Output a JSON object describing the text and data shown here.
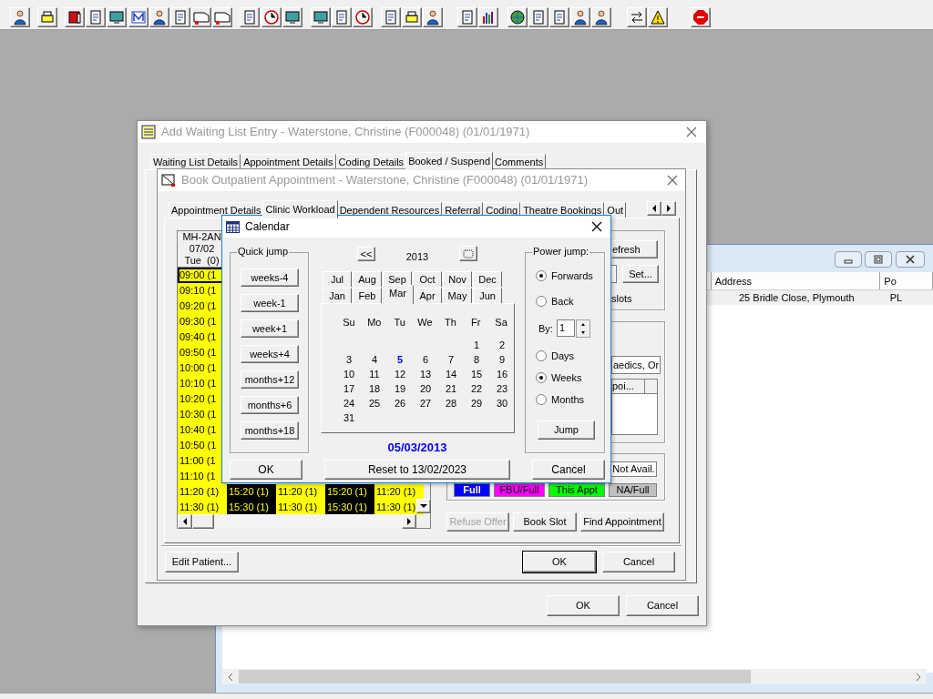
{
  "background_window": {
    "columns": [
      {
        "label": "Address"
      },
      {
        "label": "Po"
      }
    ],
    "rows": [
      {
        "cells": [
          "25 Bridle Close, Plymouth",
          "PL"
        ]
      }
    ]
  },
  "waiting_list_window": {
    "title": "Add Waiting List Entry - Waterstone, Christine (F000048) (01/01/1971)",
    "tabs": [
      {
        "label": "Waiting List Details",
        "selected": false
      },
      {
        "label": "Appointment Details",
        "selected": false
      },
      {
        "label": "Coding Details",
        "selected": false
      },
      {
        "label": "Booked / Suspend",
        "selected": true
      },
      {
        "label": "Comments",
        "selected": false
      }
    ],
    "buttons": [
      "OK",
      "Cancel"
    ]
  },
  "book_window": {
    "title": "Book Outpatient Appointment - Waterstone, Christine (F000048) (01/01/1971)",
    "tabs": [
      {
        "label": "Appointment Details",
        "selected": false
      },
      {
        "label": "Clinic Workload",
        "selected": true
      },
      {
        "label": "Dependent Resources",
        "selected": false
      },
      {
        "label": "Referral",
        "selected": false
      },
      {
        "label": "Coding",
        "selected": false
      },
      {
        "label": "Theatre Bookings",
        "selected": false
      },
      {
        "label": "Out",
        "selected": false
      }
    ],
    "grid": {
      "header": [
        "MH-2AN",
        "07/02",
        "Tue  (0)"
      ],
      "rows": [
        {
          "cells": [
            {
              "text": "09:00 (1",
              "kind": "free",
              "selected": true
            }
          ]
        },
        {
          "cells": [
            {
              "text": "09:10 (1",
              "kind": "free",
              "selected": false
            }
          ]
        },
        {
          "cells": [
            {
              "text": "09:20 (1",
              "kind": "free",
              "selected": false
            }
          ]
        },
        {
          "cells": [
            {
              "text": "09:30 (1",
              "kind": "free",
              "selected": false
            }
          ]
        },
        {
          "cells": [
            {
              "text": "09:40 (1",
              "kind": "free",
              "selected": false
            }
          ]
        },
        {
          "cells": [
            {
              "text": "09:50 (1",
              "kind": "free",
              "selected": false
            }
          ]
        },
        {
          "cells": [
            {
              "text": "10:00 (1",
              "kind": "free",
              "selected": false
            }
          ]
        },
        {
          "cells": [
            {
              "text": "10:10 (1",
              "kind": "free",
              "selected": false
            }
          ]
        },
        {
          "cells": [
            {
              "text": "10:20 (1",
              "kind": "free",
              "selected": false
            }
          ]
        },
        {
          "cells": [
            {
              "text": "10:30 (1",
              "kind": "free",
              "selected": false
            }
          ]
        },
        {
          "cells": [
            {
              "text": "10:40 (1",
              "kind": "free",
              "selected": false
            }
          ]
        },
        {
          "cells": [
            {
              "text": "10:50 (1",
              "kind": "free",
              "selected": false
            }
          ]
        },
        {
          "cells": [
            {
              "text": "11:00 (1",
              "kind": "free",
              "selected": false
            }
          ]
        },
        {
          "cells": [
            {
              "text": "11:10 (1",
              "kind": "free",
              "selected": false
            }
          ]
        },
        {
          "cells": [
            {
              "text": "11:20 (1)",
              "kind": "free",
              "selected": false
            },
            {
              "text": "15:20 (1)",
              "kind": "booked",
              "selected": false
            },
            {
              "text": "11:20 (1)",
              "kind": "free",
              "selected": false
            },
            {
              "text": "15:20 (1)",
              "kind": "booked",
              "selected": false
            },
            {
              "text": "11:20 (1)",
              "kind": "free",
              "selected": false
            }
          ]
        },
        {
          "cells": [
            {
              "text": "11:30 (1)",
              "kind": "free",
              "selected": false
            },
            {
              "text": "15:30 (1)",
              "kind": "booked",
              "selected": false
            },
            {
              "text": "11:30 (1)",
              "kind": "free",
              "selected": false
            },
            {
              "text": "15:30 (1)",
              "kind": "booked",
              "selected": false
            },
            {
              "text": "11:30 (1)",
              "kind": "free",
              "selected": false
            }
          ]
        }
      ]
    },
    "refresh_button": "efresh",
    "set_button": "Set...",
    "slots_label": "slots",
    "specialty_field": "aedics, Or",
    "list_header": "poi...",
    "legend": [
      {
        "label": "Not Avail.",
        "color": "#ffffff"
      },
      {
        "label": "Full",
        "color": "#0000ff"
      },
      {
        "label": "FBU/Full",
        "color": "#ff00ff"
      },
      {
        "label": "This Appt",
        "color": "#00ff00"
      },
      {
        "label": "NA/Full",
        "color": "#c0c0c0"
      }
    ],
    "actions": [
      {
        "label": "Refuse Offer",
        "disabled": true
      },
      {
        "label": "Book Slot",
        "disabled": false
      },
      {
        "label": "Find Appointment",
        "disabled": false
      }
    ],
    "edit_patient_button": "Edit Patient...",
    "buttons": [
      "OK",
      "Cancel"
    ]
  },
  "calendar": {
    "title": "Calendar",
    "quick_jump": {
      "label": "Quick jump",
      "buttons": [
        "weeks-4",
        "week-1",
        "week+1",
        "weeks+4",
        "months+12",
        "months+6",
        "months+18"
      ]
    },
    "prev_button": "<<",
    "year": "2013",
    "months_back_row": [
      {
        "label": "Jul",
        "selected": false
      },
      {
        "label": "Aug",
        "selected": false
      },
      {
        "label": "Sep",
        "selected": false
      },
      {
        "label": "Oct",
        "selected": false
      },
      {
        "label": "Nov",
        "selected": false
      },
      {
        "label": "Dec",
        "selected": false
      }
    ],
    "months_front_row": [
      {
        "label": "Jan",
        "selected": false
      },
      {
        "label": "Feb",
        "selected": false
      },
      {
        "label": "Mar",
        "selected": true
      },
      {
        "label": "Apr",
        "selected": false
      },
      {
        "label": "May",
        "selected": false
      },
      {
        "label": "Jun",
        "selected": false
      }
    ],
    "weekdays": [
      "Su",
      "Mo",
      "Tu",
      "We",
      "Th",
      "Fr",
      "Sa"
    ],
    "weeks": [
      [
        {
          "day": "1",
          "selected": false
        },
        {
          "day": "2",
          "selected": false
        }
      ],
      [
        {
          "day": "3",
          "selected": false
        },
        {
          "day": "4",
          "selected": false
        },
        {
          "day": "5",
          "selected": true
        },
        {
          "day": "6",
          "selected": false
        },
        {
          "day": "7",
          "selected": false
        },
        {
          "day": "8",
          "selected": false
        },
        {
          "day": "9",
          "selected": false
        }
      ],
      [
        {
          "day": "10",
          "selected": false
        },
        {
          "day": "11",
          "selected": false
        },
        {
          "day": "12",
          "selected": false
        },
        {
          "day": "13",
          "selected": false
        },
        {
          "day": "14",
          "selected": false
        },
        {
          "day": "15",
          "selected": false
        },
        {
          "day": "16",
          "selected": false
        }
      ],
      [
        {
          "day": "17",
          "selected": false
        },
        {
          "day": "18",
          "selected": false
        },
        {
          "day": "19",
          "selected": false
        },
        {
          "day": "20",
          "selected": false
        },
        {
          "day": "21",
          "selected": false
        },
        {
          "day": "22",
          "selected": false
        },
        {
          "day": "23",
          "selected": false
        }
      ],
      [
        {
          "day": "24",
          "selected": false
        },
        {
          "day": "25",
          "selected": false
        },
        {
          "day": "26",
          "selected": false
        },
        {
          "day": "27",
          "selected": false
        },
        {
          "day": "28",
          "selected": false
        },
        {
          "day": "29",
          "selected": false
        },
        {
          "day": "30",
          "selected": false
        }
      ],
      [
        {
          "day": "31",
          "selected": false
        }
      ]
    ],
    "selected_date": "05/03/2013",
    "power_jump": {
      "label": "Power jump:",
      "direction": [
        {
          "label": "Forwards",
          "selected": true
        },
        {
          "label": "Back",
          "selected": false
        }
      ],
      "by_label": "By:",
      "by_value": "1",
      "unit": [
        {
          "label": "Days",
          "selected": false
        },
        {
          "label": "Weeks",
          "selected": true
        },
        {
          "label": "Months",
          "selected": false
        }
      ],
      "jump_button": "Jump"
    },
    "ok_button": "OK",
    "reset_button": "Reset to 13/02/2023",
    "cancel_button": "Cancel"
  }
}
